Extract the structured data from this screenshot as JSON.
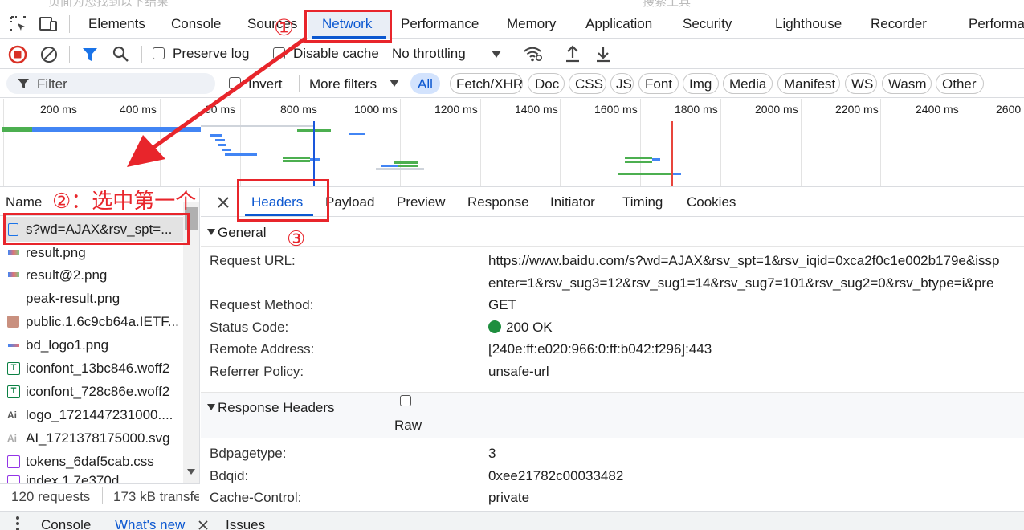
{
  "top_fragment": {
    "left": "页面为您找到以下结果",
    "right": "搜索工具"
  },
  "tabs": [
    "Elements",
    "Console",
    "Sources",
    "Network",
    "Performance",
    "Memory",
    "Application",
    "Security",
    "Lighthouse",
    "Recorder",
    "Performa"
  ],
  "toolbar": {
    "preserve_log": "Preserve log",
    "disable_cache": "Disable cache",
    "throttling": "No throttling"
  },
  "filter": {
    "placeholder": "Filter",
    "invert": "Invert",
    "more_filters": "More filters",
    "types": [
      "All",
      "Fetch/XHR",
      "Doc",
      "CSS",
      "JS",
      "Font",
      "Img",
      "Media",
      "Manifest",
      "WS",
      "Wasm",
      "Other"
    ]
  },
  "timeline": {
    "ticks": [
      "200 ms",
      "400 ms",
      "00 ms",
      "800 ms",
      "1000 ms",
      "1200 ms",
      "1400 ms",
      "1600 ms",
      "1800 ms",
      "2000 ms",
      "2200 ms",
      "2400 ms",
      "2600"
    ]
  },
  "requests": {
    "header": "Name",
    "items": [
      {
        "name": "s?wd=AJAX&rsv_spt=..."
      },
      {
        "name": "result.png"
      },
      {
        "name": "result@2.png"
      },
      {
        "name": "peak-result.png"
      },
      {
        "name": "public.1.6c9cb64a.IETF..."
      },
      {
        "name": "bd_logo1.png"
      },
      {
        "name": "iconfont_13bc846.woff2"
      },
      {
        "name": "iconfont_728c86e.woff2"
      },
      {
        "name": "logo_1721447231000...."
      },
      {
        "name": "AI_1721378175000.svg"
      },
      {
        "name": "tokens_6daf5cab.css"
      },
      {
        "name": "index.1.7e370d..."
      }
    ],
    "footer": {
      "count": "120 requests",
      "transfer": "173 kB transfe"
    }
  },
  "detail_tabs": [
    "Headers",
    "Payload",
    "Preview",
    "Response",
    "Initiator",
    "Timing",
    "Cookies"
  ],
  "general": {
    "title": "General",
    "rows": [
      {
        "label": "Request URL:",
        "line1": "https://www.baidu.com/s?wd=AJAX&rsv_spt=1&rsv_iqid=0xca2f0c1e002b179e&issp",
        "line2": "enter=1&rsv_sug3=12&rsv_sug1=14&rsv_sug7=101&rsv_sug2=0&rsv_btype=i&pre"
      },
      {
        "label": "Request Method:",
        "value": "GET"
      },
      {
        "label": "Status Code:",
        "value": "200 OK"
      },
      {
        "label": "Remote Address:",
        "value": "[240e:ff:e020:966:0:ff:b042:f296]:443"
      },
      {
        "label": "Referrer Policy:",
        "value": "unsafe-url"
      }
    ]
  },
  "response_headers": {
    "title": "Response Headers",
    "raw": "Raw",
    "rows": [
      {
        "label": "Bdpagetype:",
        "value": "3"
      },
      {
        "label": "Bdqid:",
        "value": "0xee21782c00033482"
      },
      {
        "label": "Cache-Control:",
        "value": "private"
      }
    ]
  },
  "drawer": {
    "tabs": [
      "Console",
      "What's new",
      "Issues"
    ]
  },
  "annotations": {
    "one": "①",
    "two": "②：选中第一个",
    "three": "③"
  },
  "colors": {
    "accent": "#0b57d0",
    "annotation": "#e8252b",
    "status_ok": "#1e8e3e",
    "record": "#d93025"
  }
}
